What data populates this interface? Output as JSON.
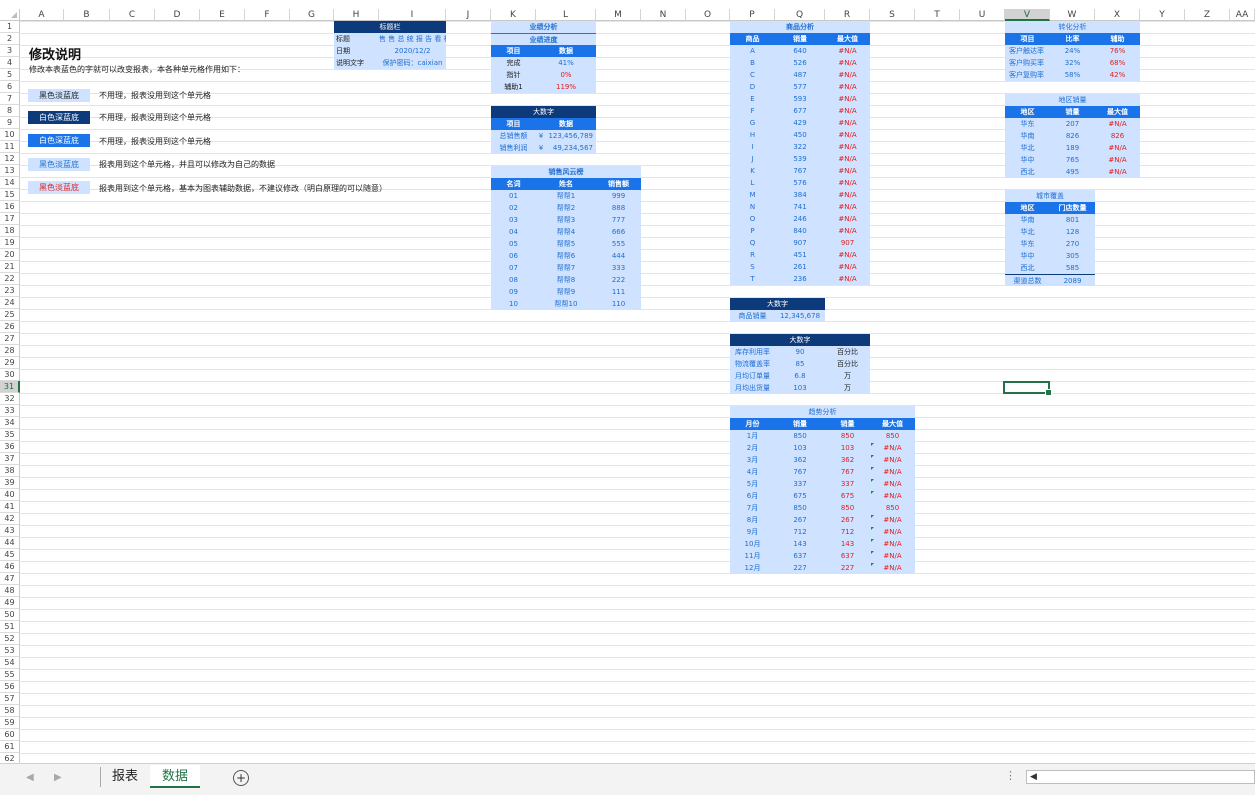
{
  "colors": {
    "light": "#cfe2ff",
    "dark": "#0d3a7a",
    "medium": "#1a73e8",
    "red": "#e02020",
    "selection": "#217346"
  },
  "columns": [
    "A",
    "B",
    "C",
    "D",
    "E",
    "F",
    "G",
    "H",
    "I",
    "J",
    "K",
    "L",
    "M",
    "N",
    "O",
    "P",
    "Q",
    "R",
    "S",
    "T",
    "U",
    "V",
    "W",
    "X",
    "Y",
    "Z",
    "AA"
  ],
  "selected_column": "V",
  "selected_row": "31",
  "rows": [
    "1",
    "2",
    "3",
    "4",
    "5",
    "6",
    "7",
    "8",
    "9",
    "10",
    "11",
    "12",
    "13",
    "14",
    "15",
    "16",
    "17",
    "18",
    "19",
    "20",
    "21",
    "22",
    "23",
    "24",
    "25",
    "26",
    "27",
    "28",
    "29",
    "30",
    "31",
    "32",
    "33",
    "34",
    "35",
    "36",
    "37",
    "38",
    "39",
    "40",
    "41",
    "42",
    "43",
    "44",
    "45",
    "46",
    "47",
    "48",
    "49",
    "50",
    "51",
    "52",
    "53",
    "54",
    "55",
    "56",
    "57",
    "58",
    "59",
    "60",
    "61",
    "62"
  ],
  "instructions": {
    "title": "修改说明",
    "subtitle": "修改本表蓝色的字就可以改变报表，本各种单元格作用如下：",
    "legend": [
      {
        "swatch": "黑色淡蓝底",
        "text": "不用理，报表没用到这个单元格"
      },
      {
        "swatch": "白色深蓝底",
        "text": "不用理，报表没用到这个单元格"
      },
      {
        "swatch": "白色深蓝底",
        "text": "不用理，报表没用到这个单元格"
      },
      {
        "swatch": "黑色淡蓝底",
        "text": "报表用到这个单元格，并且可以修改为自己的数据"
      },
      {
        "swatch": "黑色淡蓝底",
        "text": "报表用到这个单元格，基本为图表辅助数据，不建议修改（明白原理的可以随意）"
      }
    ]
  },
  "title_bar": {
    "header": "标题栏",
    "rows": [
      [
        "标题",
        "售 售 总 统 报 告 看 板"
      ],
      [
        "日期",
        "2020/12/2"
      ],
      [
        "说明文字",
        "保护密码：caixian"
      ]
    ]
  },
  "performance": {
    "title": "业绩分析",
    "subtitle": "业绩进度",
    "headers": [
      "项目",
      "数据"
    ],
    "rows": [
      [
        "完成",
        "41%"
      ],
      [
        "指针",
        "0%"
      ],
      [
        "辅助1",
        "119%"
      ]
    ]
  },
  "bignum1": {
    "title": "大数字",
    "headers": [
      "项目",
      "数据"
    ],
    "rows": [
      [
        "总销售额",
        "¥",
        "123,456,789"
      ],
      [
        "销售利润",
        "¥",
        "49,234,567"
      ]
    ]
  },
  "sales_rank": {
    "title": "销售风云榜",
    "headers": [
      "名词",
      "姓名",
      "销售额"
    ],
    "rows": [
      [
        "01",
        "帮帮1",
        "999"
      ],
      [
        "02",
        "帮帮2",
        "888"
      ],
      [
        "03",
        "帮帮3",
        "777"
      ],
      [
        "04",
        "帮帮4",
        "666"
      ],
      [
        "05",
        "帮帮5",
        "555"
      ],
      [
        "06",
        "帮帮6",
        "444"
      ],
      [
        "07",
        "帮帮7",
        "333"
      ],
      [
        "08",
        "帮帮8",
        "222"
      ],
      [
        "09",
        "帮帮9",
        "111"
      ],
      [
        "10",
        "帮帮10",
        "110"
      ]
    ]
  },
  "product": {
    "title": "商品分析",
    "headers": [
      "商品",
      "销量",
      "最大值"
    ],
    "rows": [
      [
        "A",
        "640",
        "#N/A"
      ],
      [
        "B",
        "526",
        "#N/A"
      ],
      [
        "C",
        "487",
        "#N/A"
      ],
      [
        "D",
        "577",
        "#N/A"
      ],
      [
        "E",
        "593",
        "#N/A"
      ],
      [
        "F",
        "677",
        "#N/A"
      ],
      [
        "G",
        "429",
        "#N/A"
      ],
      [
        "H",
        "450",
        "#N/A"
      ],
      [
        "I",
        "322",
        "#N/A"
      ],
      [
        "J",
        "539",
        "#N/A"
      ],
      [
        "K",
        "767",
        "#N/A"
      ],
      [
        "L",
        "576",
        "#N/A"
      ],
      [
        "M",
        "384",
        "#N/A"
      ],
      [
        "N",
        "741",
        "#N/A"
      ],
      [
        "O",
        "246",
        "#N/A"
      ],
      [
        "P",
        "840",
        "#N/A"
      ],
      [
        "Q",
        "907",
        "907"
      ],
      [
        "R",
        "451",
        "#N/A"
      ],
      [
        "S",
        "261",
        "#N/A"
      ],
      [
        "T",
        "236",
        "#N/A"
      ]
    ]
  },
  "bignum2": {
    "title": "大数字",
    "label": "商品销量",
    "value": "12,345,678"
  },
  "bignum3": {
    "title": "大数字",
    "rows": [
      [
        "库存利用率",
        "90",
        "百分比"
      ],
      [
        "物流覆盖率",
        "85",
        "百分比"
      ],
      [
        "月均订单量",
        "6.8",
        "万"
      ],
      [
        "月均出货量",
        "103",
        "万"
      ]
    ]
  },
  "trend": {
    "title": "趋势分析",
    "headers": [
      "月份",
      "销量",
      "销量",
      "最大值"
    ],
    "rows": [
      [
        "1月",
        "850",
        "850",
        "850"
      ],
      [
        "2月",
        "103",
        "103",
        "#N/A"
      ],
      [
        "3月",
        "362",
        "362",
        "#N/A"
      ],
      [
        "4月",
        "767",
        "767",
        "#N/A"
      ],
      [
        "5月",
        "337",
        "337",
        "#N/A"
      ],
      [
        "6月",
        "675",
        "675",
        "#N/A"
      ],
      [
        "7月",
        "850",
        "850",
        "850"
      ],
      [
        "8月",
        "267",
        "267",
        "#N/A"
      ],
      [
        "9月",
        "712",
        "712",
        "#N/A"
      ],
      [
        "10月",
        "143",
        "143",
        "#N/A"
      ],
      [
        "11月",
        "637",
        "637",
        "#N/A"
      ],
      [
        "12月",
        "227",
        "227",
        "#N/A"
      ]
    ]
  },
  "conversion": {
    "title": "转化分析",
    "headers": [
      "项目",
      "比率",
      "辅助"
    ],
    "rows": [
      [
        "客户触达率",
        "24%",
        "76%"
      ],
      [
        "客户购买率",
        "32%",
        "68%"
      ],
      [
        "客户复购率",
        "58%",
        "42%"
      ]
    ]
  },
  "region_sales": {
    "title": "地区销量",
    "headers": [
      "地区",
      "销量",
      "最大值"
    ],
    "rows": [
      [
        "华东",
        "207",
        "#N/A"
      ],
      [
        "华南",
        "826",
        "826"
      ],
      [
        "华北",
        "189",
        "#N/A"
      ],
      [
        "华中",
        "765",
        "#N/A"
      ],
      [
        "西北",
        "495",
        "#N/A"
      ]
    ]
  },
  "city": {
    "title": "城市覆盖",
    "headers": [
      "地区",
      "门店数量"
    ],
    "rows": [
      [
        "华南",
        "801"
      ],
      [
        "华北",
        "128"
      ],
      [
        "华东",
        "270"
      ],
      [
        "华中",
        "305"
      ],
      [
        "西北",
        "585"
      ]
    ],
    "total": [
      "渠道总数",
      "2089"
    ]
  },
  "tabs": {
    "report": "报表",
    "data": "数据",
    "add": "+"
  },
  "scroll": {
    "left": "◀",
    "dots": "⋮"
  },
  "nav": {
    "prev": "◀",
    "next": "▶"
  }
}
